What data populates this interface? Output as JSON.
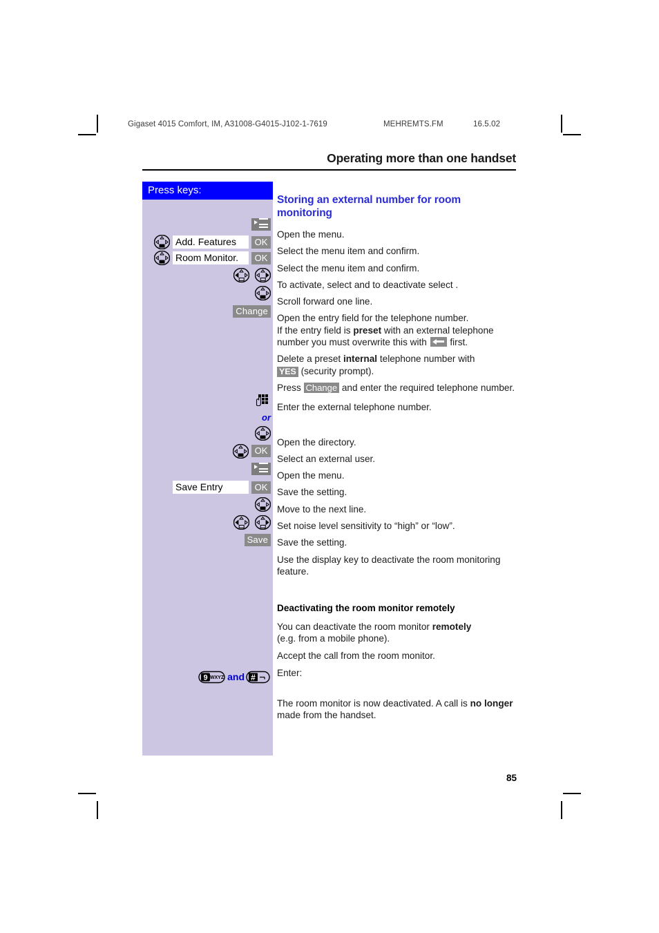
{
  "header": {
    "doc_id": "Gigaset 4015 Comfort, IM, A31008-G4015-J102-1-7619",
    "file_name": "MEHREMTS.FM",
    "date": "16.5.02",
    "chapter_title": "Operating more than one handset"
  },
  "keys_panel": {
    "title": "Press keys:",
    "rows": [
      {
        "icons": [
          "menu-icon"
        ]
      },
      {
        "icons": [
          "nav-down-key"
        ],
        "field": "Add. Features",
        "ok": "OK"
      },
      {
        "icons": [
          "nav-down-key"
        ],
        "field": "Room Monitor.",
        "ok": "OK"
      },
      {
        "icons": [
          "nav-left-key",
          "nav-right-key"
        ]
      },
      {
        "icons": [
          "nav-down-key"
        ]
      },
      {
        "soft": "Change"
      },
      {
        "icons": [
          "keypad-icon"
        ]
      },
      {
        "or": "or"
      },
      {
        "icons": [
          "nav-down-key"
        ]
      },
      {
        "icons": [
          "nav-down-key"
        ],
        "ok": "OK"
      },
      {
        "icons": [
          "menu-icon"
        ]
      },
      {
        "icons": [],
        "field": "Save Entry",
        "ok": "OK"
      },
      {
        "icons": [
          "nav-down-key"
        ]
      },
      {
        "icons": [
          "nav-left-key",
          "nav-right-key"
        ]
      },
      {
        "soft": "Save"
      },
      {
        "key9": "9",
        "key9sub": "WXYZ",
        "and": "and",
        "keyhash": "#"
      }
    ],
    "labels": {
      "menu_icon": "menu-icon",
      "keypad_icon": "keypad-icon",
      "nav_down": "nav-down-key",
      "nav_left": "nav-left-key",
      "nav_right": "nav-right-key",
      "ok": "OK",
      "change": "Change",
      "save": "Save",
      "field_add_features": "Add. Features",
      "field_room_monitor": "Room Monitor.",
      "field_save_entry": "Save Entry",
      "or": "or",
      "and": "and",
      "key9_digit": "9",
      "key9_letters": "WXYZ",
      "key_hash": "#"
    }
  },
  "content": {
    "section_title": "Storing an external number for room monitoring",
    "steps": [
      "Open the menu.",
      "Select the menu item and confirm.",
      "Select the menu item and confirm.",
      "To activate, select  and to deactivate select .",
      "Scroll forward one line."
    ],
    "entry_field_para": {
      "line1": "Open the entry field for the telephone number.",
      "line2_a": "If the entry field is ",
      "line2_bold": "preset",
      "line2_b": " with an external telephone",
      "line3_a": "number you must overwrite this with ",
      "line3_b": " first."
    },
    "delete_para": {
      "a": "Delete a preset ",
      "bold": "internal",
      "b": " telephone number with",
      "yes_key": "YES",
      "c": " (security prompt)."
    },
    "press_change_para": {
      "a": "Press ",
      "change_key": "Change",
      "b": " and enter the required telephone number."
    },
    "steps2": [
      "Enter the external telephone number.",
      "Open the directory.",
      "Select an external user.",
      "Open the menu.",
      "Save the setting.",
      "Move to the next line.",
      "Set noise level sensitivity to “high” or “low”.",
      "Save the setting.",
      "Use the display key  to deactivate the room monitoring feature."
    ],
    "subsection": {
      "heading": "Deactivating the room monitor remotely",
      "p1_a": "You can deactivate the room monitor ",
      "p1_bold": "remotely",
      "p1_b": "",
      "p1_line2": "(e.g. from a mobile phone).",
      "p2": "Accept the call from the room monitor.",
      "p3": "Enter:",
      "p4_a": "The room monitor is now deactivated. A call is ",
      "p4_bold1": "no longer",
      "p4_b": " made from the handset."
    }
  },
  "footer": {
    "page_number": "85"
  }
}
